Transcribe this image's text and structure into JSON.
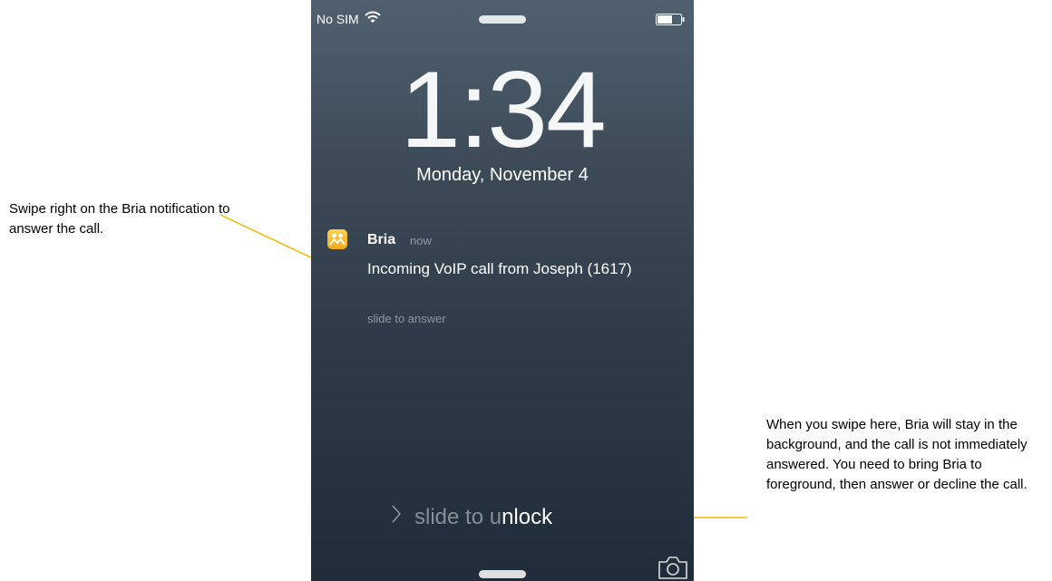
{
  "status_bar": {
    "carrier": "No SIM",
    "icons": {
      "wifi": "wifi-icon",
      "battery": "battery-icon"
    }
  },
  "lock_screen": {
    "time": "1:34",
    "date": "Monday, November 4"
  },
  "notification": {
    "app_name": "Bria",
    "time": "now",
    "message": "Incoming VoIP call from Joseph (1617)",
    "action_hint": "slide to answer",
    "icon": "bria-app-icon",
    "icon_color": "#f7b928"
  },
  "unlock": {
    "prefix": "slide to u",
    "highlight": "nlock",
    "icon": "chevron-right-icon"
  },
  "bottom": {
    "icon": "camera-icon"
  },
  "callouts": {
    "left": "Swipe right on the Bria notification to answer the call.",
    "right": "When you swipe here, Bria will stay in the background, and the call is not immediately answered. You need to bring Bria to foreground, then answer or decline the call."
  },
  "colors": {
    "leader_line": "#f5b800"
  }
}
